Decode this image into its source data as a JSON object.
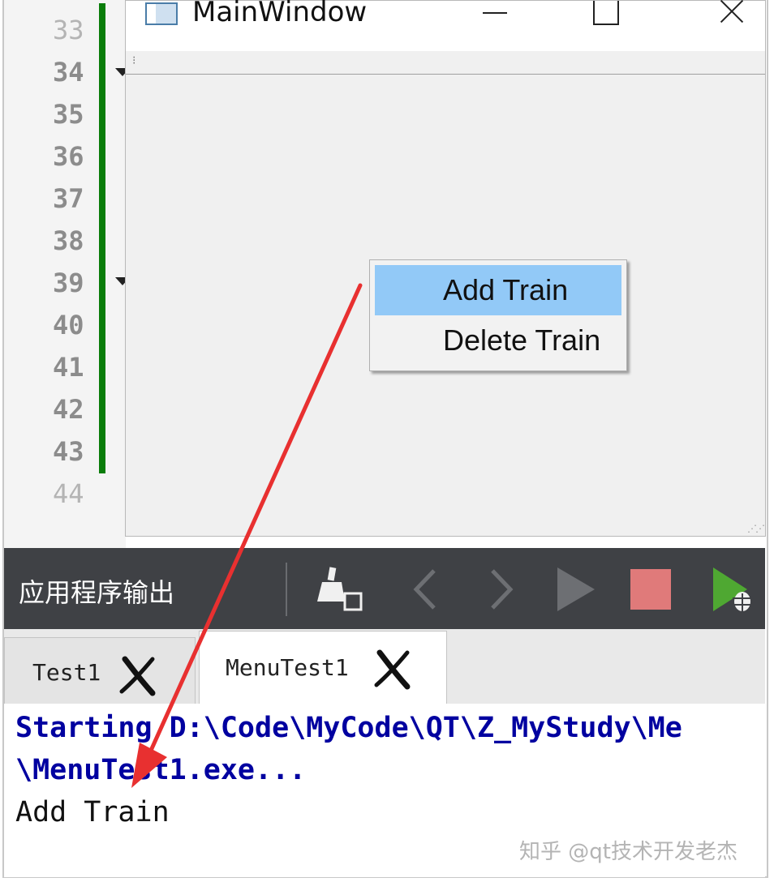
{
  "editor": {
    "line_numbers": [
      "33",
      "34",
      "35",
      "36",
      "37",
      "38",
      "39",
      "40",
      "41",
      "42",
      "43",
      "44"
    ]
  },
  "main_window": {
    "title": "MainWindow"
  },
  "context_menu": {
    "items": [
      {
        "label": "Add Train",
        "highlighted": true
      },
      {
        "label": "Delete Train",
        "highlighted": false
      }
    ]
  },
  "output_pane": {
    "title": "应用程序输出",
    "tabs": [
      {
        "label": "Test1",
        "active": false
      },
      {
        "label": "MenuTest1",
        "active": true
      }
    ],
    "lines": [
      "Starting D:\\Code\\MyCode\\QT\\Z_MyStudy\\Me",
      "\\MenuTest1.exe...",
      "Add Train"
    ]
  },
  "watermark": "知乎 @qt技术开发老杰",
  "colors": {
    "highlight": "#92c9f7",
    "change_bar": "#0a7d0a",
    "output_blue": "#0000a0",
    "stop": "#e07a7a",
    "run_green": "#4fa832",
    "annotation_arrow": "#e83030"
  }
}
